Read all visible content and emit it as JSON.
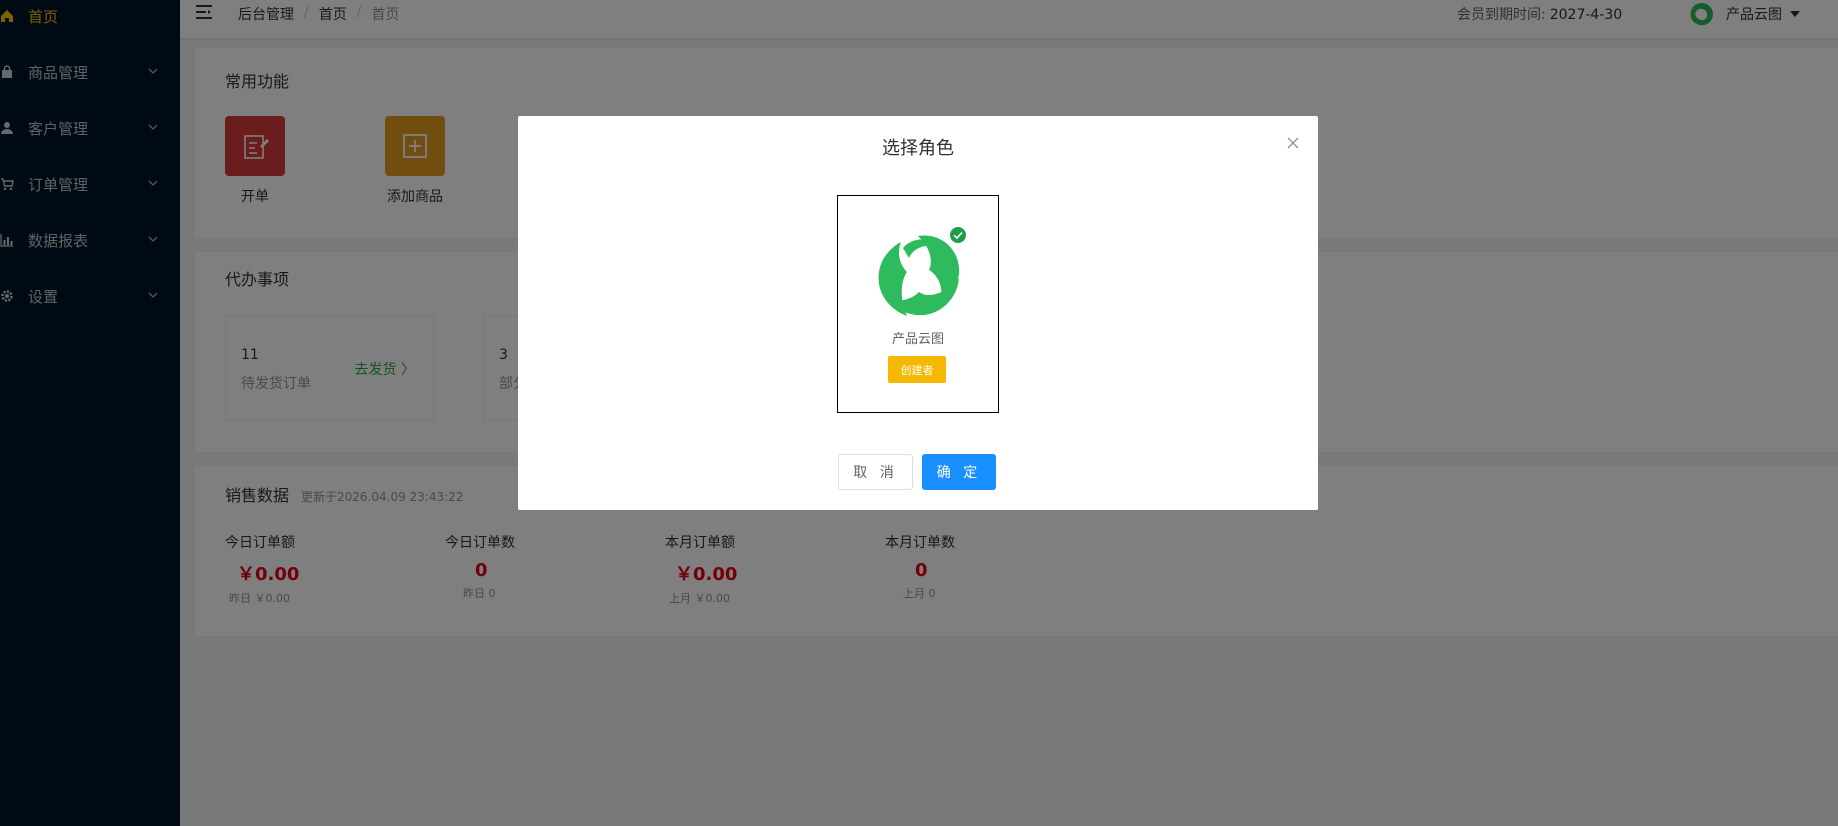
{
  "sidebar": {
    "items": [
      {
        "label": "首页",
        "icon": "home-icon",
        "active": true
      },
      {
        "label": "商品管理",
        "icon": "bag-icon"
      },
      {
        "label": "客户管理",
        "icon": "user-icon"
      },
      {
        "label": "订单管理",
        "icon": "cart-icon"
      },
      {
        "label": "数据报表",
        "icon": "chart-icon"
      },
      {
        "label": "设置",
        "icon": "gear-icon"
      }
    ]
  },
  "header": {
    "breadcrumb": [
      "后台管理",
      "首页",
      "首页"
    ],
    "breadcrumb_sep": "/",
    "expiry_label": "会员到期时间:",
    "expiry_date": "2027-4-30",
    "user_name": "产品云图"
  },
  "quick": {
    "title": "常用功能",
    "items": [
      {
        "label": "开单",
        "color": "#d63a3a",
        "icon": "edit-note-icon"
      },
      {
        "label": "添加商品",
        "color": "#e39a1f",
        "icon": "add-square-icon"
      }
    ]
  },
  "todo": {
    "title": "代办事项",
    "items": [
      {
        "count": "11",
        "label": "待发货订单",
        "link": "去发货 〉"
      },
      {
        "count": "3",
        "label": "部分"
      }
    ]
  },
  "sales": {
    "title": "销售数据",
    "updated": "更新于2026.04.09 23:43:22",
    "stats": [
      {
        "label": "今日订单额",
        "value": "￥0.00",
        "sub": "昨日 ￥0.00"
      },
      {
        "label": "今日订单数",
        "value": "0",
        "sub": "昨日 0"
      },
      {
        "label": "本月订单额",
        "value": "￥0.00",
        "sub": "上月 ￥0.00"
      },
      {
        "label": "本月订单数",
        "value": "0",
        "sub": "上月 0"
      }
    ]
  },
  "modal": {
    "title": "选择角色",
    "role": {
      "name": "产品云图",
      "badge": "创建者"
    },
    "cancel": "取 消",
    "ok": "确 定"
  },
  "colors": {
    "accent": "#1890ff",
    "brand_green": "#2dbb5d",
    "price_red": "#e60012",
    "badge": "#f5b800",
    "sidebar_bg": "#001529"
  }
}
